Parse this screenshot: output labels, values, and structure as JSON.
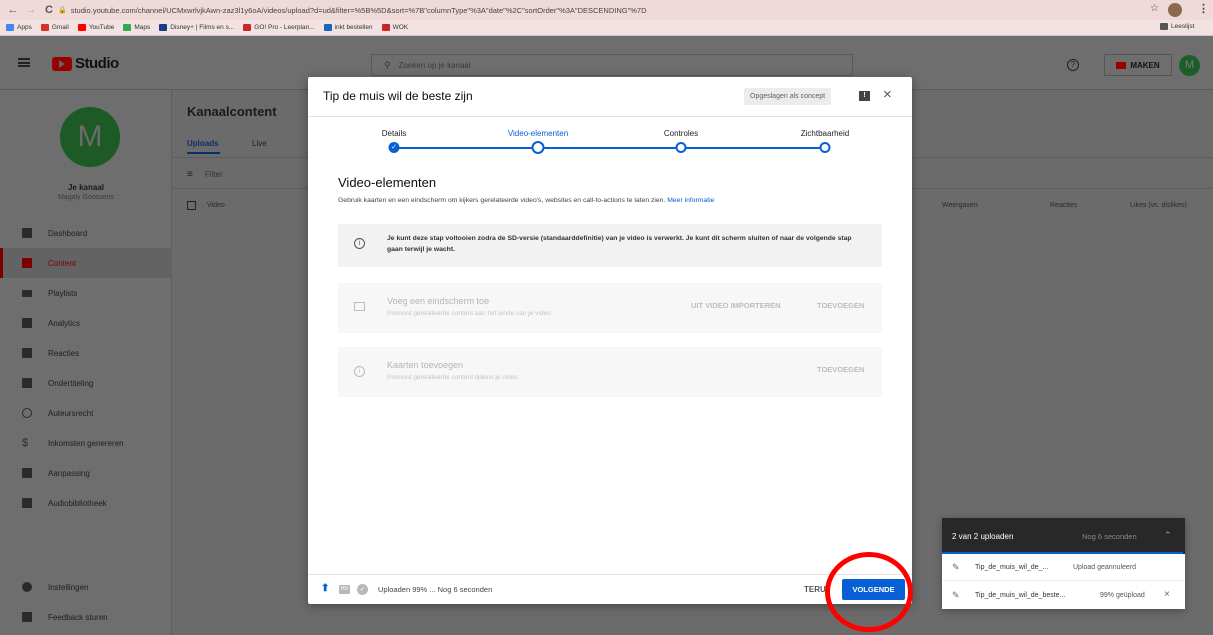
{
  "browser": {
    "url": "studio.youtube.com/channel/UCMxwrlvjkAwn-zaz3l1y6oA/videos/upload?d=ud&filter=%5B%5D&sort=%7B\"columnType\"%3A\"date\"%2C\"sortOrder\"%3A\"DESCENDING\"%7D",
    "bookmarks": [
      {
        "label": "Apps",
        "color": "#4285f4"
      },
      {
        "label": "Gmail",
        "color": "#d93025"
      },
      {
        "label": "YouTube",
        "color": "#ff0000"
      },
      {
        "label": "Maps",
        "color": "#34a853"
      },
      {
        "label": "Disney+ | Films en s...",
        "color": "#1a3a8a"
      },
      {
        "label": "GO! Pro - Leerplan...",
        "color": "#c62828"
      },
      {
        "label": "inkt bestellen",
        "color": "#1565c0"
      },
      {
        "label": "WOK",
        "color": "#c62828"
      }
    ],
    "reading_list": "Leeslijst"
  },
  "header": {
    "logo": "Studio",
    "search_placeholder": "Zoeken op je kanaal",
    "create_label": "MAKEN",
    "avatar_letter": "M"
  },
  "sidebar": {
    "avatar_letter": "M",
    "channel_title": "Je kanaal",
    "channel_name": "Magaly Goossens",
    "items": [
      {
        "label": "Dashboard",
        "icon": "dashboard-icon",
        "active": false
      },
      {
        "label": "Content",
        "icon": "content-icon",
        "active": true
      },
      {
        "label": "Playlists",
        "icon": "playlists-icon",
        "active": false
      },
      {
        "label": "Analytics",
        "icon": "analytics-icon",
        "active": false
      },
      {
        "label": "Reacties",
        "icon": "comments-icon",
        "active": false
      },
      {
        "label": "Ondertiteling",
        "icon": "subtitles-icon",
        "active": false
      },
      {
        "label": "Auteursrecht",
        "icon": "copyright-icon",
        "active": false
      },
      {
        "label": "Inkomsten genereren",
        "icon": "dollar-icon",
        "active": false
      },
      {
        "label": "Aanpassing",
        "icon": "customization-icon",
        "active": false
      },
      {
        "label": "Audiobibliotheek",
        "icon": "audio-library-icon",
        "active": false
      }
    ],
    "settings_label": "Instellingen",
    "feedback_label": "Feedback sturen"
  },
  "content": {
    "title": "Kanaalcontent",
    "tabs": [
      "Uploads",
      "Live"
    ],
    "filter_label": "Filter",
    "columns": [
      "Video",
      "Weergaven",
      "Reacties",
      "Likes (vs. dislikes)"
    ]
  },
  "dialog": {
    "title": "Tip de muis wil de beste zijn",
    "draft_badge": "Opgeslagen als concept",
    "steps": [
      {
        "label": "Details",
        "state": "done"
      },
      {
        "label": "Video-elementen",
        "state": "current"
      },
      {
        "label": "Controles",
        "state": "todo"
      },
      {
        "label": "Zichtbaarheid",
        "state": "todo"
      }
    ],
    "section_title": "Video-elementen",
    "section_desc": "Gebruik kaarten en een eindscherm om kijkers gerelateerde video's, websites en call-to-actions te laten zien.",
    "more_info": "Meer informatie",
    "notice": "Je kunt deze stap voltooien zodra de SD-versie (standaarddefinitie) van je video is verwerkt. Je kunt dit scherm sluiten of naar de volgende stap gaan terwijl je wacht.",
    "endscreen": {
      "title": "Voeg een eindscherm toe",
      "desc": "Promoot gerelateerde content aan het einde van je video",
      "import_label": "UIT VIDEO IMPORTEREN",
      "add_label": "TOEVOEGEN"
    },
    "cards": {
      "title": "Kaarten toevoegen",
      "desc": "Promoot gerelateerde content tijdens je video",
      "add_label": "TOEVOEGEN"
    },
    "footer": {
      "status": "Uploaden 99% ... Nog 6 seconden",
      "back_label": "TERU",
      "next_label": "VOLGENDE"
    }
  },
  "uploads_panel": {
    "title": "2 van 2 uploaden",
    "eta": "Nog 6 seconden",
    "items": [
      {
        "name": "Tip_de_muis_wil_de_...",
        "status": "Upload geannuleerd"
      },
      {
        "name": "Tip_de_muis_wil_de_beste...",
        "status": "99% geüpload"
      }
    ]
  },
  "colors": {
    "accent": "#065fd4",
    "youtube_red": "#ff0000",
    "annotation_red": "#ff0000",
    "overlay": "#6b6b6b",
    "upload_panel_header": "#282828"
  }
}
